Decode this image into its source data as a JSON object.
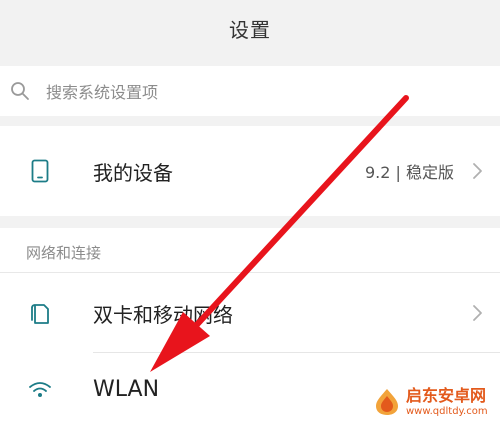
{
  "header": {
    "title": "设置"
  },
  "search": {
    "placeholder": "搜索系统设置项",
    "icon": "search-icon"
  },
  "device_row": {
    "label": "我的设备",
    "version": "9.2 | 稳定版",
    "icon": "phone-icon"
  },
  "section_network": {
    "title": "网络和连接"
  },
  "sim_row": {
    "label": "双卡和移动网络",
    "icon": "sim-cards-icon"
  },
  "wlan_row": {
    "label": "WLAN",
    "icon": "wifi-icon"
  },
  "watermark": {
    "text": "启东安卓网",
    "url": "www.qdltdy.com"
  },
  "colors": {
    "accent": "#1c7c87",
    "annotation_arrow": "#e8141c",
    "watermark": "#e35a1c"
  }
}
